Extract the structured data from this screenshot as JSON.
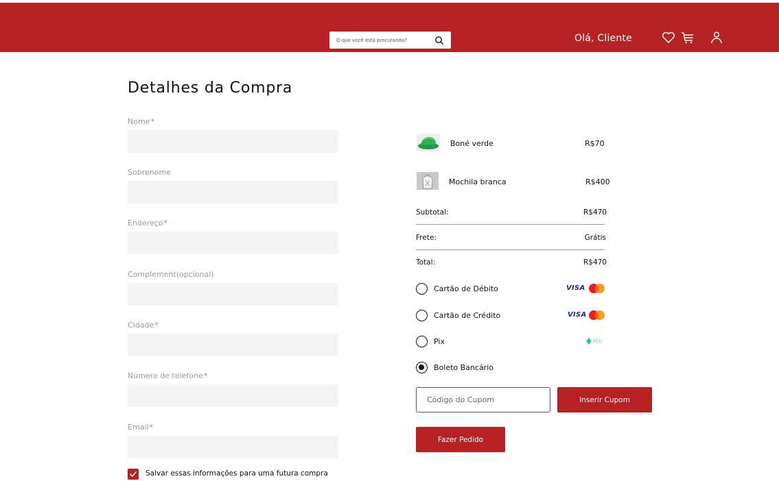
{
  "header": {
    "search_placeholder": "O que você está procurando?",
    "greeting": "Olá, Cliente",
    "icons": [
      "heart-icon",
      "cart-icon",
      "user-icon",
      "search-icon"
    ]
  },
  "form": {
    "title": "Detalhes da Compra",
    "fields": [
      {
        "label": "Nome",
        "required": "*"
      },
      {
        "label": "Sobrenome",
        "required": ""
      },
      {
        "label": "Endereço",
        "required": "*"
      },
      {
        "label": "Complement(opcional)",
        "required": ""
      },
      {
        "label": "Cidade",
        "required": "*"
      },
      {
        "label": "Número de telefone",
        "required": "*"
      },
      {
        "label": "Email",
        "required": "*"
      }
    ],
    "save_label": "Salvar essas informações para uma futura compra",
    "save_checked": true
  },
  "order": {
    "items": [
      {
        "name": "Boné verde",
        "price": "R$70"
      },
      {
        "name": "Mochila branca",
        "price": "R$400"
      }
    ],
    "subtotal_label": "Subtotal:",
    "subtotal_value": "R$470",
    "shipping_label": "Frete:",
    "shipping_value": "Grátis",
    "total_label": "Total:",
    "total_value": "R$470",
    "payment_methods": [
      {
        "label": "Cartão de Débito",
        "brand": "VISA",
        "selected": false
      },
      {
        "label": "Cartão de Crédito",
        "brand": "VISA",
        "selected": false
      },
      {
        "label": "Pix",
        "selected": false
      },
      {
        "label": "Boleto Bancário",
        "selected": true
      }
    ],
    "coupon_placeholder": "Código do Cupom",
    "coupon_button": "Inserir Cupom",
    "order_button": "Fazer Pedido"
  },
  "colors": {
    "brand_red": "#b72324",
    "field_bg": "#f4f4f4"
  }
}
